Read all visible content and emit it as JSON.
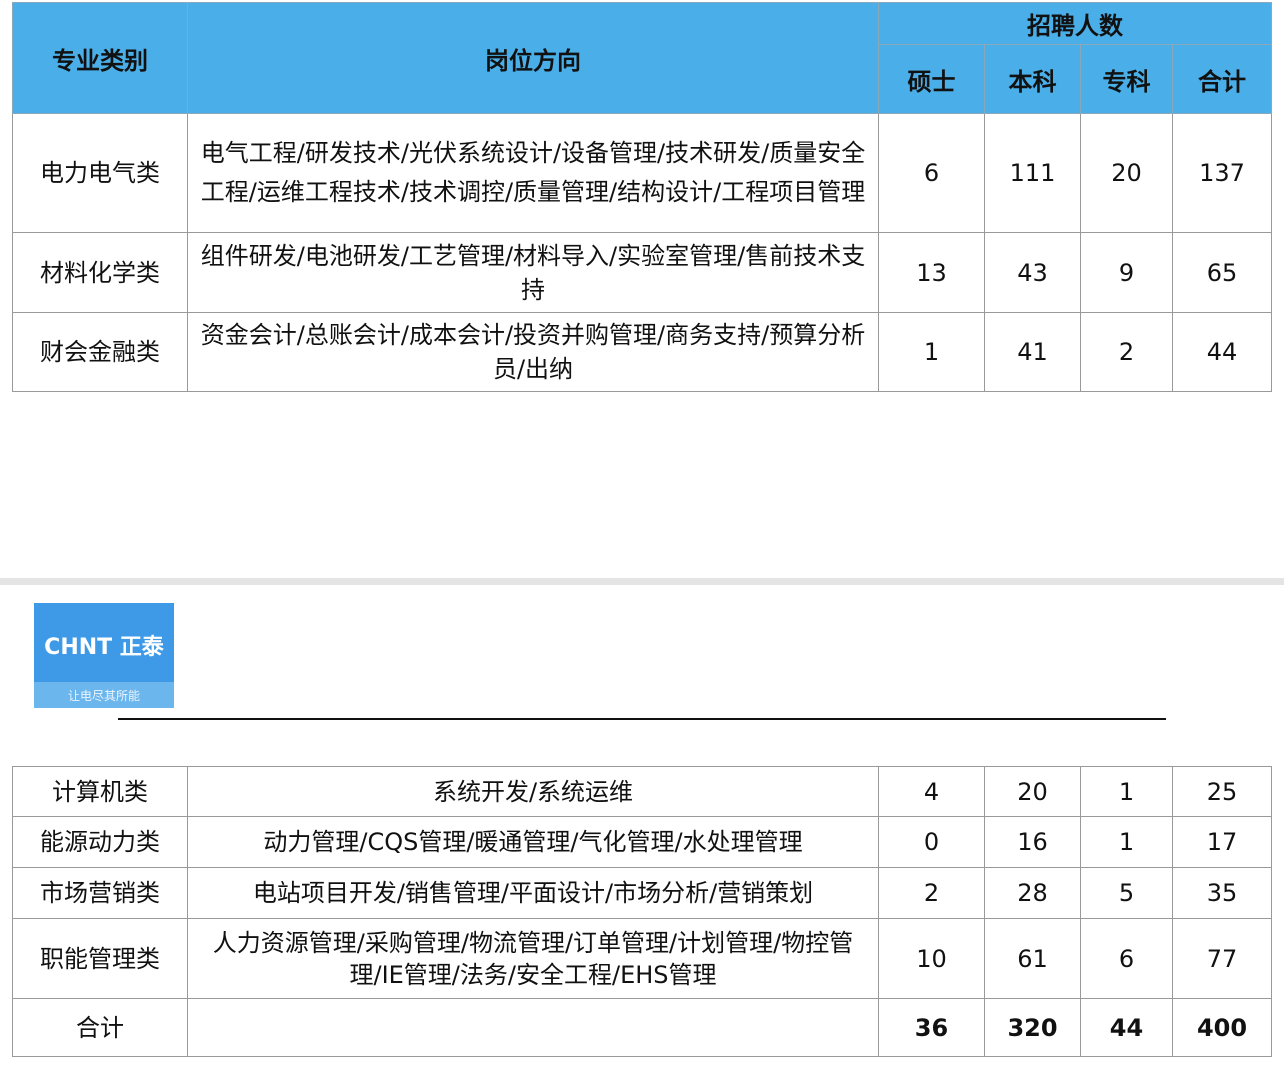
{
  "header": {
    "category": "专业类别",
    "position": "岗位方向",
    "recruit": "招聘人数",
    "master": "硕士",
    "bachelor": "本科",
    "college": "专科",
    "total": "合计"
  },
  "rows_top": [
    {
      "category": "电力电气类",
      "position": "电气工程/研发技术/光伏系统设计/设备管理/技术研发/质量安全工程/运维工程技术/技术调控/质量管理/结构设计/工程项目管理",
      "master": "6",
      "bachelor": "111",
      "college": "20",
      "total": "137"
    },
    {
      "category": "材料化学类",
      "position": "组件研发/电池研发/工艺管理/材料导入/实验室管理/售前技术支持",
      "master": "13",
      "bachelor": "43",
      "college": "9",
      "total": "65"
    },
    {
      "category": "财会金融类",
      "position": "资金会计/总账会计/成本会计/投资并购管理/商务支持/预算分析员/出纳",
      "master": "1",
      "bachelor": "41",
      "college": "2",
      "total": "44"
    }
  ],
  "logo": {
    "brand": "CHNT 正泰",
    "slogan": "让电尽其所能"
  },
  "rows_bottom": [
    {
      "category": "计算机类",
      "position": "系统开发/系统运维",
      "master": "4",
      "bachelor": "20",
      "college": "1",
      "total": "25"
    },
    {
      "category": "能源动力类",
      "position": "动力管理/CQS管理/暖通管理/气化管理/水处理管理",
      "master": "0",
      "bachelor": "16",
      "college": "1",
      "total": "17"
    },
    {
      "category": "市场营销类",
      "position": "电站项目开发/销售管理/平面设计/市场分析/营销策划",
      "master": "2",
      "bachelor": "28",
      "college": "5",
      "total": "35"
    },
    {
      "category": "职能管理类",
      "position": "人力资源管理/采购管理/物流管理/订单管理/计划管理/物控管理/IE管理/法务/安全工程/EHS管理",
      "master": "10",
      "bachelor": "61",
      "college": "6",
      "total": "77"
    }
  ],
  "total_row": {
    "label": "合计",
    "position": "",
    "master": "36",
    "bachelor": "320",
    "college": "44",
    "total": "400"
  }
}
